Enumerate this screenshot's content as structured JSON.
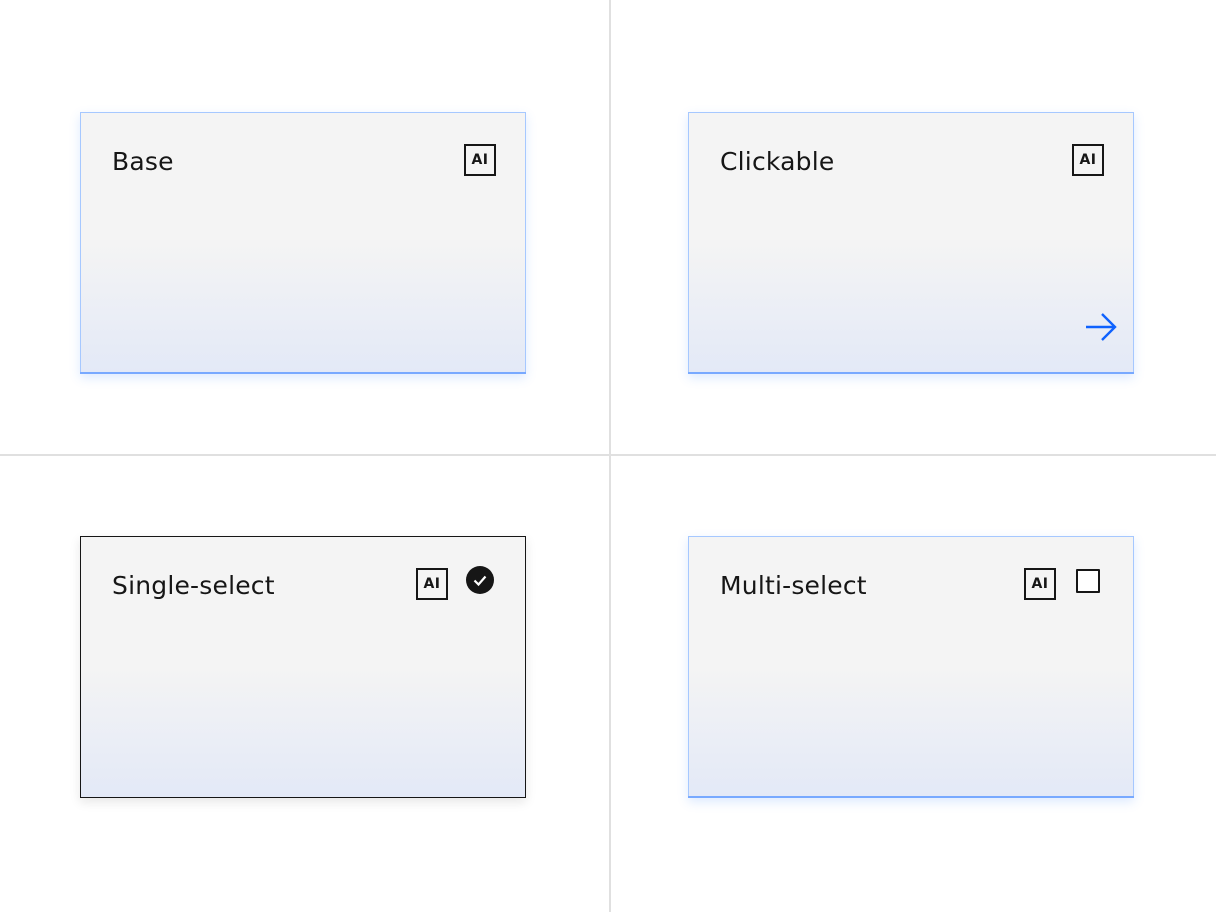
{
  "colors": {
    "tile_border": "#a6c8ff",
    "tile_accent": "#78a9ff",
    "selected_border": "#161616",
    "arrow": "#0f62fe",
    "divider": "#e0e0e0",
    "text": "#161616"
  },
  "tiles": [
    {
      "variant": "base",
      "title": "Base",
      "badge": "AI",
      "icons": []
    },
    {
      "variant": "clickable",
      "title": "Clickable",
      "badge": "AI",
      "icons": [
        "arrow-right-icon"
      ]
    },
    {
      "variant": "single-select",
      "title": "Single-select",
      "badge": "AI",
      "selected": true,
      "icons": [
        "checkmark-filled-icon"
      ]
    },
    {
      "variant": "multi-select",
      "title": "Multi-select",
      "badge": "AI",
      "selected": false,
      "icons": [
        "checkbox-icon"
      ]
    }
  ]
}
